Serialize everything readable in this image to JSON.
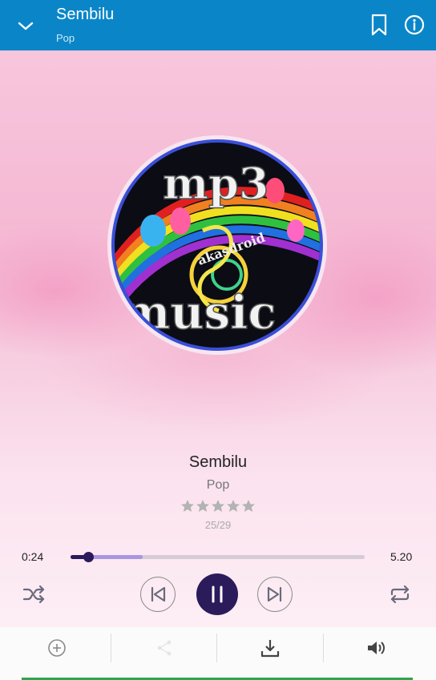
{
  "header": {
    "title": "Sembilu",
    "subtitle": "Pop",
    "icons": {
      "collapse": "chevron-down-icon",
      "bookmark": "bookmark-icon",
      "info": "info-icon"
    }
  },
  "artwork": {
    "text_top": "mp3",
    "text_bottom": "music",
    "text_mid": "akasdroid"
  },
  "now_playing": {
    "title": "Sembilu",
    "genre": "Pop",
    "rating": 0,
    "rating_max": 5,
    "counter": "25/29"
  },
  "progress": {
    "current": "0:24",
    "total": "5.20",
    "played_fraction": 0.06,
    "buffered_fraction": 0.245
  },
  "controls": {
    "icons": [
      "shuffle-icon",
      "previous-icon",
      "pause-icon",
      "next-icon",
      "repeat-icon"
    ]
  },
  "bottom_bar": {
    "icons": [
      "add-playlist-icon",
      "share-icon",
      "download-icon",
      "volume-icon"
    ]
  },
  "colors": {
    "header": "#0a86c8",
    "accent": "#2b1b5a",
    "buffer": "#a996e0",
    "bottom_line": "#2ea44f"
  }
}
